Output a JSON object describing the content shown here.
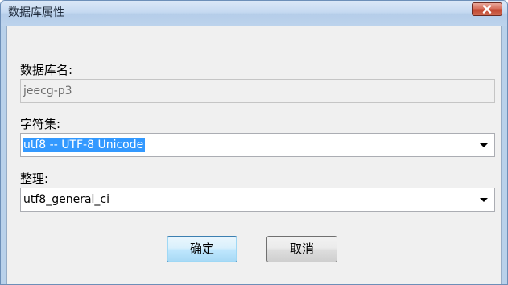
{
  "window": {
    "title": "数据库属性",
    "close_icon": "close-icon"
  },
  "form": {
    "db_name_label": "数据库名:",
    "db_name_value": "jeecg-p3",
    "charset_label": "字符集:",
    "charset_value": "utf8 -- UTF-8 Unicode",
    "collation_label": "整理:",
    "collation_value": "utf8_general_ci"
  },
  "buttons": {
    "ok_label": "确定",
    "cancel_label": "取消"
  },
  "colors": {
    "selection": "#3399ff",
    "close_button": "#c1462f",
    "default_button_border": "#3c7fb1"
  }
}
